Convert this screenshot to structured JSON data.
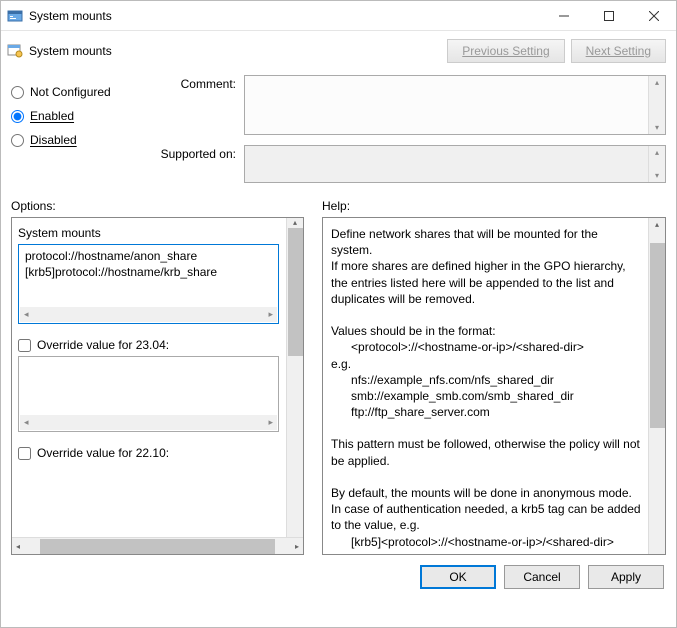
{
  "window": {
    "title": "System mounts",
    "min_tooltip": "Minimize",
    "max_tooltip": "Maximize",
    "close_tooltip": "Close"
  },
  "header": {
    "label": "System mounts",
    "prev_btn": "Previous Setting",
    "next_btn": "Next Setting"
  },
  "state_radios": {
    "not_configured": "Not Configured",
    "enabled": "Enabled",
    "disabled": "Disabled",
    "selected": "enabled"
  },
  "fields": {
    "comment_label": "Comment:",
    "comment_value": "",
    "supported_label": "Supported on:",
    "supported_value": ""
  },
  "columns": {
    "options_label": "Options:",
    "help_label": "Help:"
  },
  "options": {
    "group_label": "System mounts",
    "entries": [
      "protocol://hostname/anon_share",
      "[krb5]protocol://hostname/krb_share"
    ],
    "override_2304_label": "Override value for 23.04:",
    "override_2304_checked": false,
    "override_2210_label": "Override value for 22.10:",
    "override_2210_checked": false
  },
  "help_text": "Define network shares that will be mounted for the system.\nIf more shares are defined higher in the GPO hierarchy, the entries listed here will be appended to the list and duplicates will be removed.\n\nValues should be in the format:\n      <protocol>://<hostname-or-ip>/<shared-dir>\ne.g.\n      nfs://example_nfs.com/nfs_shared_dir\n      smb://example_smb.com/smb_shared_dir\n      ftp://ftp_share_server.com\n\nThis pattern must be followed, otherwise the policy will not be applied.\n\nBy default, the mounts will be done in anonymous mode. In case of authentication needed, a krb5 tag can be added to the value, e.g.\n      [krb5]<protocol>://<hostname-or-ip>/<shared-dir>\n\nIf the tag is added, the mount will require Kerberos",
  "footer": {
    "ok": "OK",
    "cancel": "Cancel",
    "apply": "Apply"
  }
}
